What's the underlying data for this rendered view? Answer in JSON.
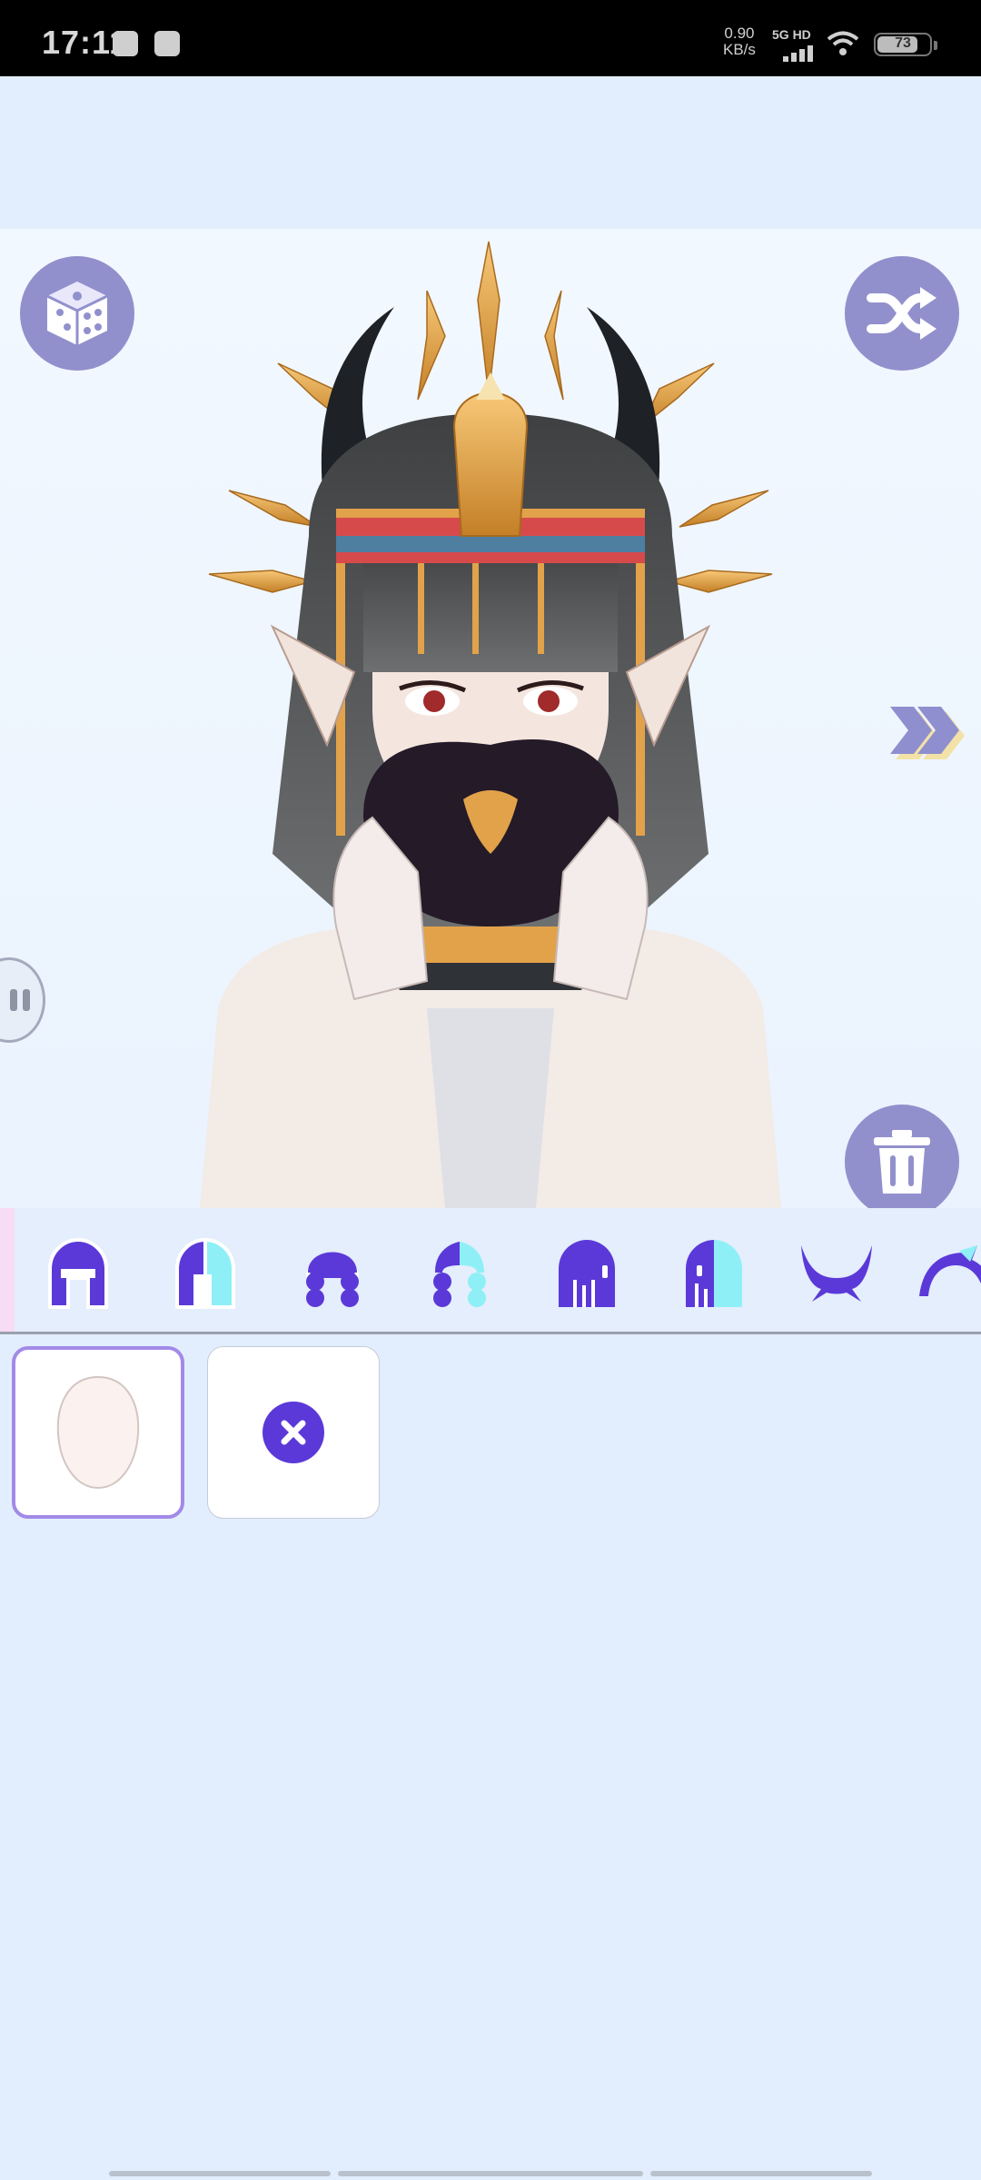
{
  "status_bar": {
    "time": "17:11",
    "net_speed_value": "0.90",
    "net_speed_unit": "KB/s",
    "network": "5G HD",
    "battery_level": "73",
    "icons": [
      "check-notification-icon",
      "mail-notification-icon",
      "signal-icon",
      "wifi-icon",
      "battery-icon"
    ]
  },
  "stage": {
    "buttons": [
      "dice-random-icon",
      "shuffle-icon",
      "next-chevrons-icon",
      "trash-icon",
      "side-drawer-handle"
    ],
    "character": "character-avatar-preview"
  },
  "categories": {
    "items": [
      {
        "name": "hair-front-solid-icon",
        "selected": false
      },
      {
        "name": "hair-front-split-icon",
        "selected": false
      },
      {
        "name": "hair-braid-solid-icon",
        "selected": false
      },
      {
        "name": "hair-braid-split-icon",
        "selected": false
      },
      {
        "name": "hair-long-solid-icon",
        "selected": false
      },
      {
        "name": "hair-long-split-icon",
        "selected": false
      },
      {
        "name": "horns-icon",
        "selected": false
      },
      {
        "name": "ears-icon",
        "selected": false
      }
    ]
  },
  "options": {
    "items": [
      {
        "name": "face-shape-option",
        "selected": true
      },
      {
        "name": "none-option",
        "selected": false
      }
    ]
  },
  "colors": {
    "accent": "#9290cc",
    "category_icon": "#5b39d8",
    "category_icon_split": "#8ef0f6",
    "selection_border": "#a28ae8",
    "background": "#e2eefd"
  }
}
